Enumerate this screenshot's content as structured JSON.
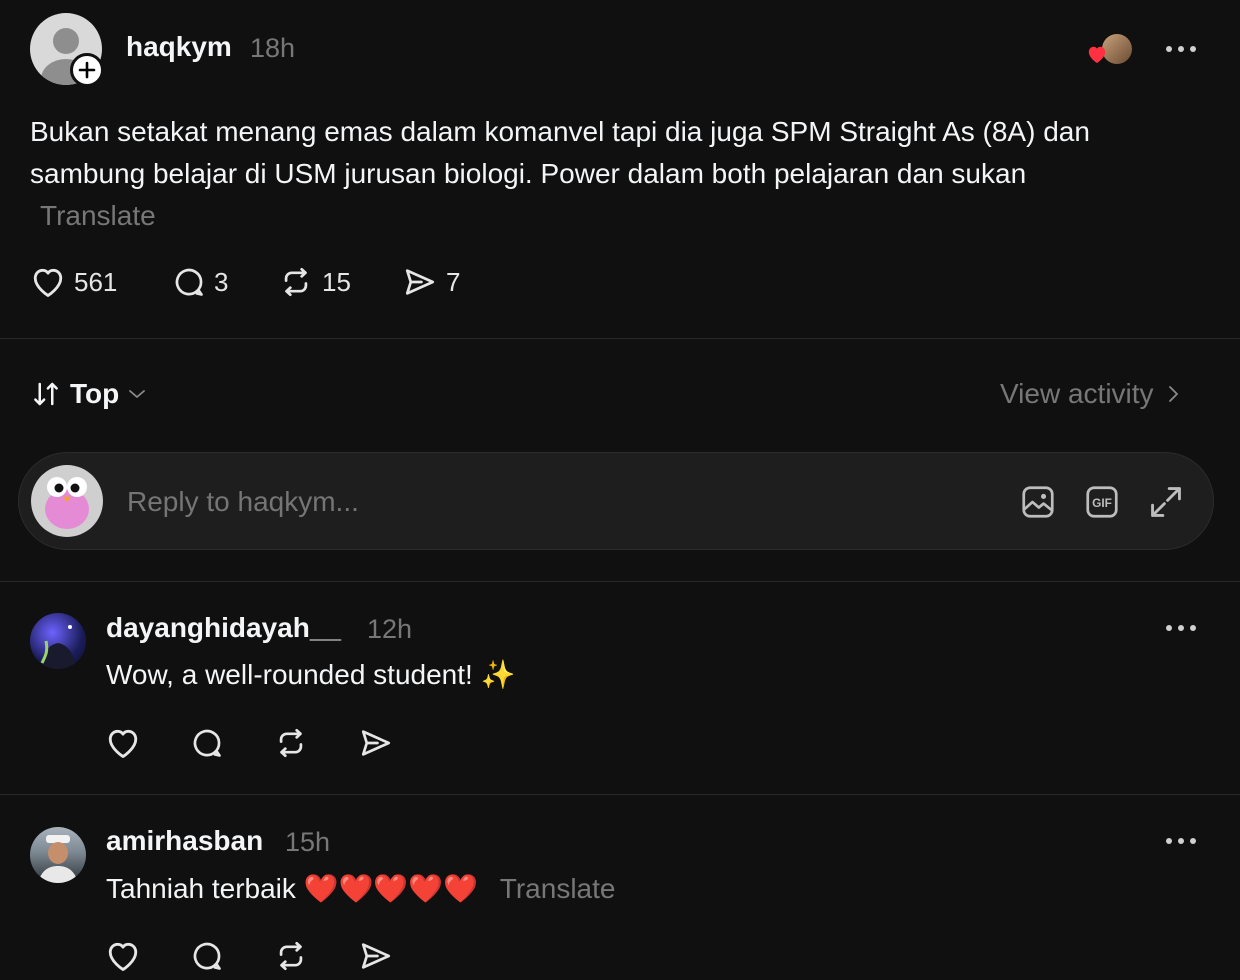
{
  "post": {
    "username": "haqkym",
    "time": "18h",
    "body": "Bukan setakat menang emas dalam komanvel tapi dia juga SPM Straight As (8A) dan sambung belajar di USM jurusan biologi. Power dalam both pelajaran dan sukan",
    "translate": "Translate",
    "likes": "561",
    "replies": "3",
    "reposts": "15",
    "shares": "7"
  },
  "sort": {
    "label": "Top",
    "view_activity": "View activity"
  },
  "reply_box": {
    "placeholder": "Reply to haqkym..."
  },
  "comments": [
    {
      "username": "dayanghidayah__",
      "time": "12h",
      "text": "Wow, a well-rounded student! ✨"
    },
    {
      "username": "amirhasban",
      "time": "15h",
      "text": "Tahniah terbaik ❤️❤️❤️❤️❤️",
      "translate": "Translate"
    }
  ],
  "colors": {
    "background": "#101010",
    "text": "#f3f5f7",
    "muted": "#777777",
    "heart_red": "#ff3040"
  }
}
